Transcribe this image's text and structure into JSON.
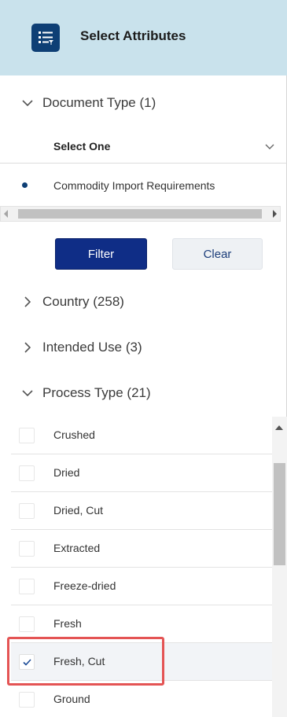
{
  "header": {
    "title": "Select Attributes",
    "icon": "list-filter-icon"
  },
  "document_type": {
    "label": "Document Type (1)",
    "expanded": true,
    "select_label": "Select One",
    "selected_item": "Commodity Import Requirements"
  },
  "buttons": {
    "filter": "Filter",
    "clear": "Clear"
  },
  "sections": {
    "country": "Country (258)",
    "intended_use": "Intended Use (3)",
    "process_type": "Process Type (21)"
  },
  "process_items": [
    {
      "label": "Crushed",
      "checked": false
    },
    {
      "label": "Dried",
      "checked": false
    },
    {
      "label": "Dried, Cut",
      "checked": false
    },
    {
      "label": "Extracted",
      "checked": false
    },
    {
      "label": "Freeze-dried",
      "checked": false
    },
    {
      "label": "Fresh",
      "checked": false
    },
    {
      "label": "Fresh, Cut",
      "checked": true
    },
    {
      "label": "Ground",
      "checked": false
    }
  ],
  "colors": {
    "header_bg": "#c9e2ec",
    "icon_bg": "#0e3f75",
    "filter_button": "#0f2d86",
    "highlight_border": "#e45454"
  }
}
